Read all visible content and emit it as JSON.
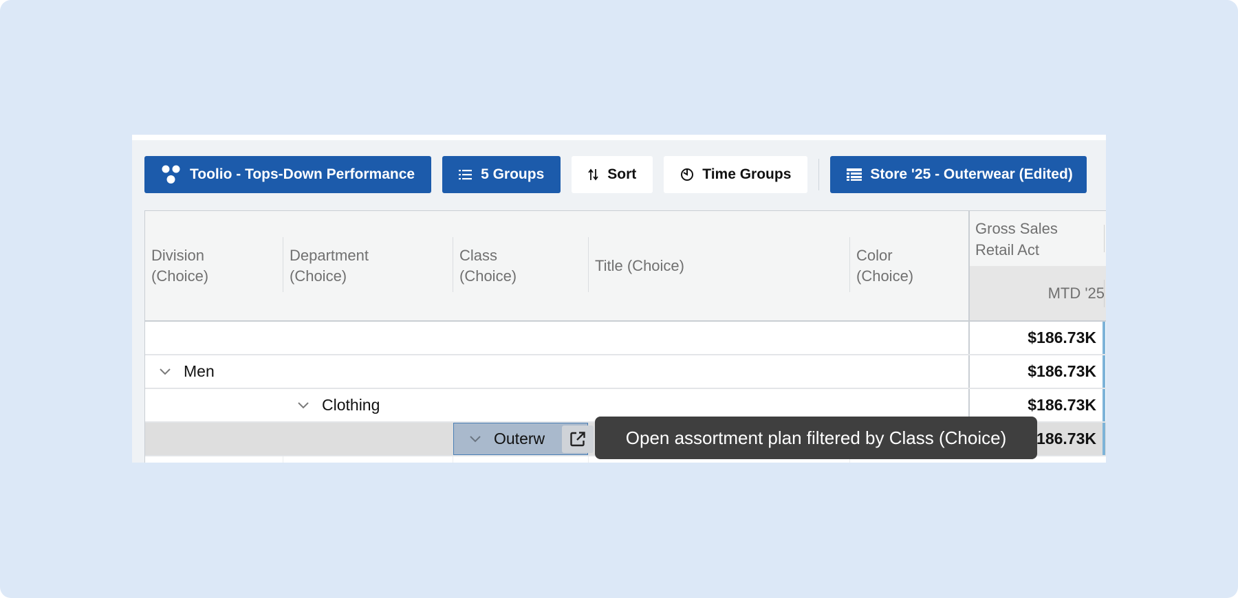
{
  "toolbar": {
    "view_label": "Toolio - Tops-Down Performance",
    "groups_label": "5 Groups",
    "sort_label": "Sort",
    "time_groups_label": "Time Groups",
    "store_label": "Store '25 - Outerwear (Edited)"
  },
  "grid": {
    "columns": [
      "Division\n(Choice)",
      "Department\n(Choice)",
      "Class\n(Choice)",
      "Title (Choice)",
      "Color\n(Choice)"
    ],
    "col_division_line1": "Division",
    "col_division_line2": "(Choice)",
    "col_department_line1": "Department",
    "col_department_line2": "(Choice)",
    "col_class_line1": "Class",
    "col_class_line2": "(Choice)",
    "col_title": "Title (Choice)",
    "col_color_line1": "Color",
    "col_color_line2": "(Choice)",
    "metric_line1": "Gross Sales",
    "metric_line2": "Retail Act",
    "metric_period": "MTD '25",
    "rows": [
      {
        "label": "",
        "value": "$186.73K"
      },
      {
        "label": "Men",
        "value": "$186.73K"
      },
      {
        "label": "Clothing",
        "value": "$186.73K"
      },
      {
        "label": "Outerw",
        "value": "$186.73K"
      }
    ]
  },
  "tooltip": {
    "text": "Open assortment plan filtered by Class (Choice)"
  },
  "colors": {
    "primary_button": "#1c5bab",
    "page_bg": "#dce8f7",
    "tooltip_bg": "#3f3f3f",
    "selection": "#a9b9cc"
  }
}
